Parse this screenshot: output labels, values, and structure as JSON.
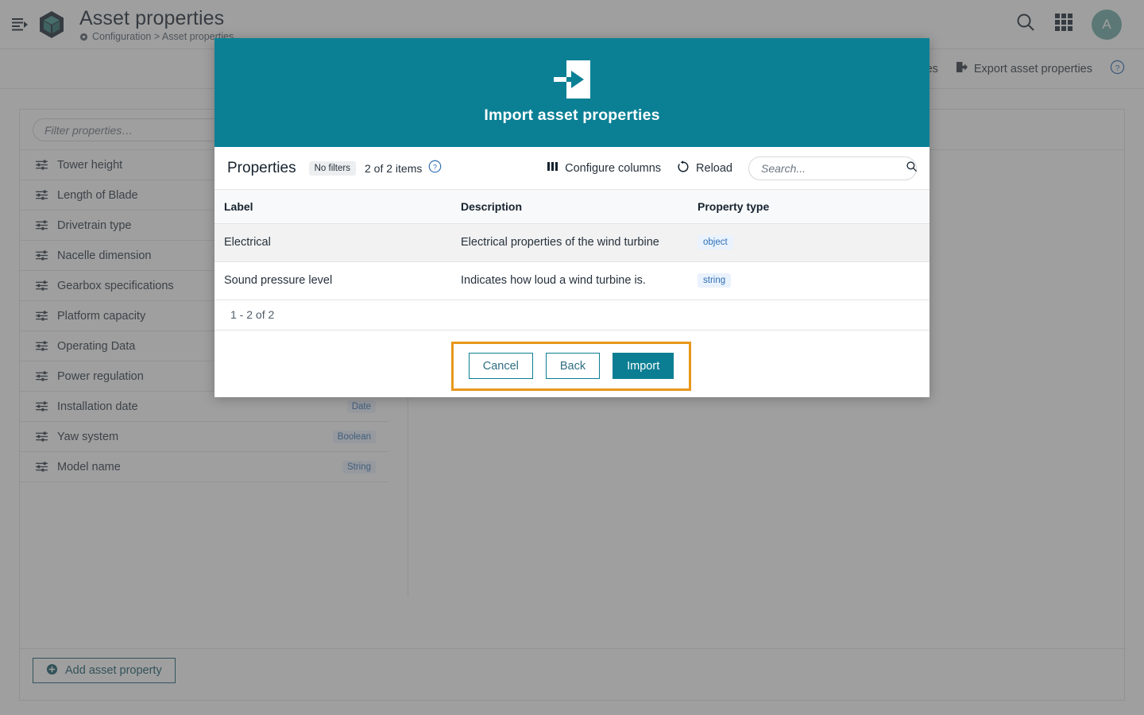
{
  "topbar": {
    "menu_icon": "sidebar-toggle-icon",
    "logo_icon": "cube-logo-icon",
    "title": "Asset properties",
    "breadcrumb_gear_icon": "gear-icon",
    "breadcrumb": "Configuration > Asset properties",
    "search_icon": "search-icon",
    "apps_icon": "apps-grid-icon",
    "avatar_initial": "A"
  },
  "actionbar": {
    "import_label": "...ties",
    "export_icon": "export-icon",
    "export_label": "Export asset properties",
    "help_icon": "help-circle-icon"
  },
  "page": {
    "filter_placeholder": "Filter properties…",
    "filter_value": "",
    "properties": [
      {
        "label": "Tower height",
        "type": ""
      },
      {
        "label": "Length of Blade",
        "type": ""
      },
      {
        "label": "Drivetrain type",
        "type": ""
      },
      {
        "label": "Nacelle dimension",
        "type": ""
      },
      {
        "label": "Gearbox specifications",
        "type": ""
      },
      {
        "label": "Platform capacity",
        "type": ""
      },
      {
        "label": "Operating Data",
        "type": ""
      },
      {
        "label": "Power regulation",
        "type": ""
      },
      {
        "label": "Installation date",
        "type": "Date"
      },
      {
        "label": "Yaw system",
        "type": "Boolean"
      },
      {
        "label": "Model name",
        "type": "String"
      }
    ],
    "add_button_icon": "plus-circle-icon",
    "add_button_label": "Add asset property"
  },
  "modal": {
    "header_icon": "import-arrow-icon",
    "header_title": "Import asset properties",
    "toolbar": {
      "title": "Properties",
      "filters_chip": "No filters",
      "items_count": "2 of 2 items",
      "help_icon": "help-circle-icon",
      "configure_icon": "columns-icon",
      "configure_label": "Configure columns",
      "reload_icon": "reload-icon",
      "reload_label": "Reload",
      "search_placeholder": "Search...",
      "search_value": "",
      "search_icon": "search-icon"
    },
    "table": {
      "columns": [
        "Label",
        "Description",
        "Property type"
      ],
      "rows": [
        {
          "label": "Electrical",
          "description": "Electrical properties of the wind turbine",
          "property_type": "object"
        },
        {
          "label": "Sound pressure level",
          "description": "Indicates how loud a wind turbine is.",
          "property_type": "string"
        }
      ]
    },
    "pagination": "1 - 2 of 2",
    "buttons": {
      "cancel": "Cancel",
      "back": "Back",
      "import": "Import"
    }
  },
  "colors": {
    "teal": "#0b8095",
    "teal_button": "#0b7e93",
    "highlight_orange": "#e8971b",
    "badge_blue_bg": "#e9f2fd",
    "badge_blue_text": "#2f6fb5",
    "avatar_bg": "#6aa9a4"
  }
}
